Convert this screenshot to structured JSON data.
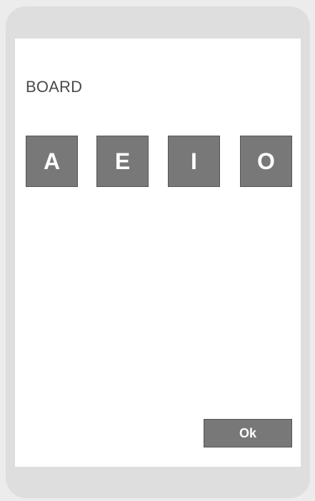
{
  "board": {
    "title": "BOARD",
    "tiles": [
      {
        "letter": "A"
      },
      {
        "letter": "E"
      },
      {
        "letter": "I"
      },
      {
        "letter": "O"
      }
    ]
  },
  "actions": {
    "ok_label": "Ok"
  },
  "colors": {
    "page_background": "#ececec",
    "device_frame": "#dedede",
    "screen": "#ffffff",
    "tile": "#787878",
    "tile_text": "#ffffff",
    "title_text": "#4a4a4a"
  }
}
